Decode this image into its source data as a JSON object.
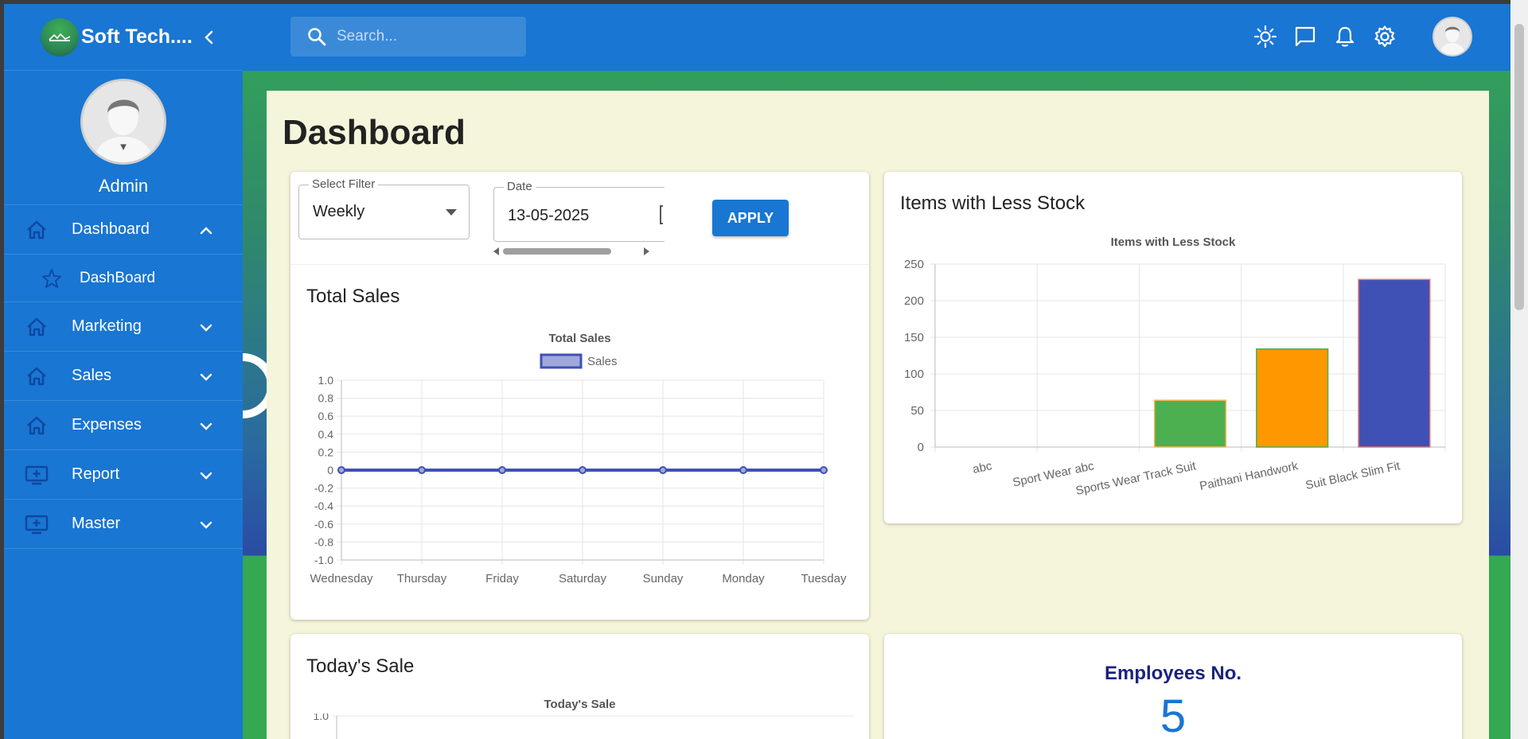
{
  "brand": {
    "name": "Soft Tech...."
  },
  "profile": {
    "name": "Admin"
  },
  "sidebar": {
    "items": [
      {
        "label": "Dashboard",
        "icon": "home-icon",
        "expanded": true
      },
      {
        "label": "DashBoard",
        "icon": "star-icon",
        "sub": true
      },
      {
        "label": "Marketing",
        "icon": "home-icon"
      },
      {
        "label": "Sales",
        "icon": "home-icon"
      },
      {
        "label": "Expenses",
        "icon": "home-icon"
      },
      {
        "label": "Report",
        "icon": "add-to-queue-icon"
      },
      {
        "label": "Master",
        "icon": "add-to-queue-icon"
      }
    ]
  },
  "topbar": {
    "search_placeholder": "Search...",
    "icons": [
      "brightness-icon",
      "chat-icon",
      "bell-icon",
      "gear-icon",
      "avatar"
    ]
  },
  "page": {
    "title": "Dashboard"
  },
  "filter": {
    "select_label": "Select Filter",
    "select_value": "Weekly",
    "date_label": "Date",
    "date_value": "13-05-2025",
    "apply_label": "APPLY"
  },
  "cards": {
    "total_sales": "Total Sales",
    "less_stock": "Items with Less Stock",
    "todays_sale": "Today's Sale",
    "employees_title": "Employees No.",
    "employees_value": "5"
  },
  "colors": {
    "primary": "#1976d2",
    "content_bg": "#f5f5dc",
    "green": "#34a853"
  },
  "chart_data": [
    {
      "type": "line",
      "title": "Total Sales",
      "categories": [
        "Wednesday",
        "Thursday",
        "Friday",
        "Saturday",
        "Sunday",
        "Monday",
        "Tuesday"
      ],
      "series": [
        {
          "name": "Sales",
          "values": [
            0,
            0,
            0,
            0,
            0,
            0,
            0
          ],
          "color": "#3f51b5"
        }
      ],
      "y_ticks": [
        "1.0",
        "0.8",
        "0.6",
        "0.4",
        "0.2",
        "0",
        "-0.2",
        "-0.4",
        "-0.6",
        "-0.8",
        "-1.0"
      ],
      "ylim": [
        -1.0,
        1.0
      ],
      "legend": "top",
      "grid": true
    },
    {
      "type": "bar",
      "title": "Items with Less Stock",
      "categories": [
        "abc",
        "Sport Wear abc",
        "Sports Wear Track Suit",
        "Paithani Handwork",
        "Suit Black Slim Fit"
      ],
      "values": [
        0,
        0,
        64,
        134,
        229
      ],
      "colors": [
        "#4caf50",
        "#4caf50",
        "#4caf50",
        "#ff9800",
        "#3f51b5"
      ],
      "y_ticks": [
        "250",
        "200",
        "150",
        "100",
        "50",
        "0"
      ],
      "ylim": [
        0,
        250
      ],
      "grid": true
    },
    {
      "type": "line",
      "title": "Today's Sale",
      "y_ticks": [
        "1.0"
      ],
      "grid": true
    }
  ]
}
